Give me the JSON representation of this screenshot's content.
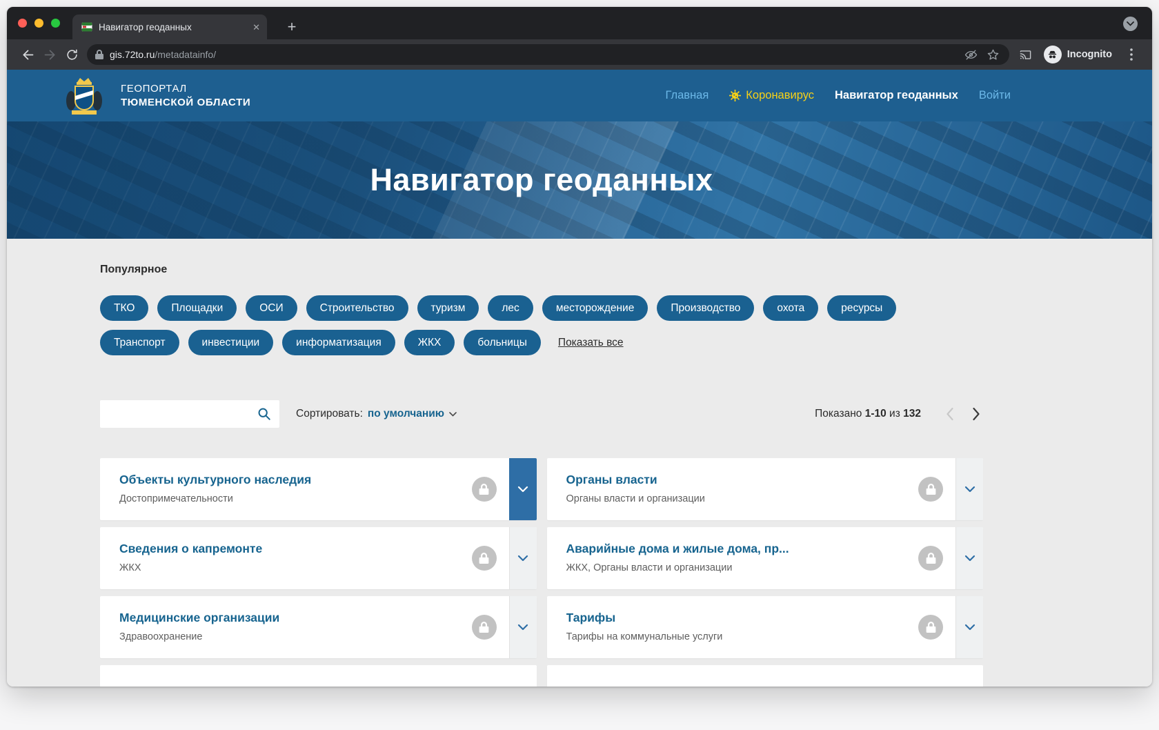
{
  "browser": {
    "tab_title": "Навигатор геоданных",
    "url": {
      "domain": "gis.72to.ru",
      "path": "/metadatainfo/"
    },
    "incognito_label": "Incognito"
  },
  "header": {
    "logo_line1": "ГЕОПОРТАЛ",
    "logo_line2": "ТЮМЕНСКОЙ ОБЛАСТИ",
    "nav": [
      {
        "label": "Главная"
      },
      {
        "label": "Коронавирус"
      },
      {
        "label": "Навигатор геоданных"
      },
      {
        "label": "Войти"
      }
    ]
  },
  "hero": {
    "title": "Навигатор геоданных"
  },
  "popular": {
    "heading": "Популярное",
    "tags": [
      "ТКО",
      "Площадки",
      "ОСИ",
      "Строительство",
      "туризм",
      "лес",
      "месторождение",
      "Производство",
      "охота",
      "ресурсы",
      "Транспорт",
      "инвестиции",
      "информатизация",
      "ЖКХ",
      "больницы"
    ],
    "show_all_label": "Показать все"
  },
  "toolbar": {
    "search_value": "",
    "sort_label": "Сортировать:",
    "sort_value": "по умолчанию",
    "results": {
      "shown_label": "Показано",
      "range": "1-10",
      "of_label": "из",
      "total": "132"
    }
  },
  "cards": [
    {
      "title": "Объекты культурного наследия",
      "subtitle": "Достопримечательности",
      "expanded": true
    },
    {
      "title": "Органы власти",
      "subtitle": "Органы власти и организации",
      "expanded": false
    },
    {
      "title": "Сведения о капремонте",
      "subtitle": "ЖКХ",
      "expanded": false
    },
    {
      "title": "Аварийные дома и жилые дома, пр...",
      "subtitle": "ЖКХ, Органы власти и организации",
      "expanded": false
    },
    {
      "title": "Медицинские организации",
      "subtitle": "Здравоохранение",
      "expanded": false
    },
    {
      "title": "Тарифы",
      "subtitle": "Тарифы на коммунальные услуги",
      "expanded": false
    }
  ],
  "colors": {
    "brand_blue": "#1E5F90",
    "tag_blue": "#1A6191",
    "link_light_blue": "#6CB8E8",
    "coronavirus_yellow": "#F7D117",
    "card_title_blue": "#17648F",
    "expand_blue": "#2E6EA6"
  }
}
